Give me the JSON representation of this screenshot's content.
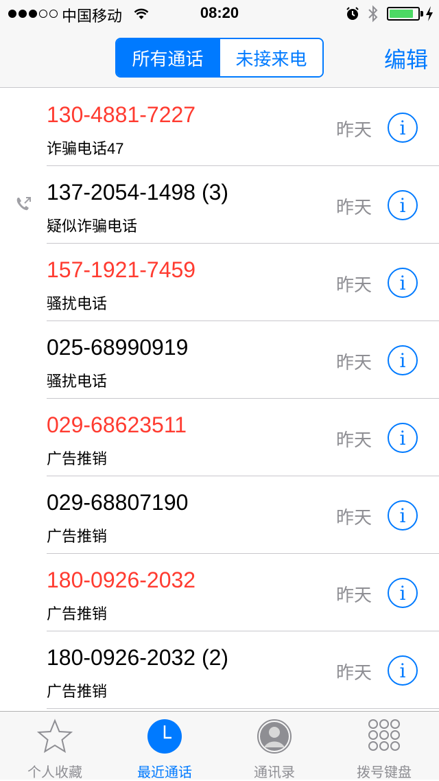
{
  "status_bar": {
    "carrier": "中国移动",
    "time": "08:20",
    "signal_bars": 3,
    "battery_level": 0.85
  },
  "nav": {
    "segments": [
      "所有通话",
      "未接来电"
    ],
    "active_segment": 0,
    "edit_label": "编辑"
  },
  "calls": [
    {
      "number": "130-4881-7227",
      "label": "诈骗电话47",
      "date": "昨天",
      "missed": true,
      "outgoing": false
    },
    {
      "number": "137-2054-1498  (3)",
      "label": "疑似诈骗电话",
      "date": "昨天",
      "missed": false,
      "outgoing": true
    },
    {
      "number": "157-1921-7459",
      "label": "骚扰电话",
      "date": "昨天",
      "missed": true,
      "outgoing": false
    },
    {
      "number": "025-68990919",
      "label": "骚扰电话",
      "date": "昨天",
      "missed": false,
      "outgoing": false
    },
    {
      "number": "029-68623511",
      "label": "广告推销",
      "date": "昨天",
      "missed": true,
      "outgoing": false
    },
    {
      "number": "029-68807190",
      "label": "广告推销",
      "date": "昨天",
      "missed": false,
      "outgoing": false
    },
    {
      "number": "180-0926-2032",
      "label": "广告推销",
      "date": "昨天",
      "missed": true,
      "outgoing": false
    },
    {
      "number": "180-0926-2032  (2)",
      "label": "广告推销",
      "date": "昨天",
      "missed": false,
      "outgoing": false
    }
  ],
  "info_glyph": "i",
  "tabs": [
    {
      "label": "个人收藏",
      "icon": "star-icon"
    },
    {
      "label": "最近通话",
      "icon": "clock-icon"
    },
    {
      "label": "通讯录",
      "icon": "contacts-icon"
    },
    {
      "label": "拨号键盘",
      "icon": "keypad-icon"
    }
  ],
  "active_tab": 1,
  "colors": {
    "accent": "#007aff",
    "missed": "#ff3b30",
    "secondary": "#8e8e93"
  }
}
